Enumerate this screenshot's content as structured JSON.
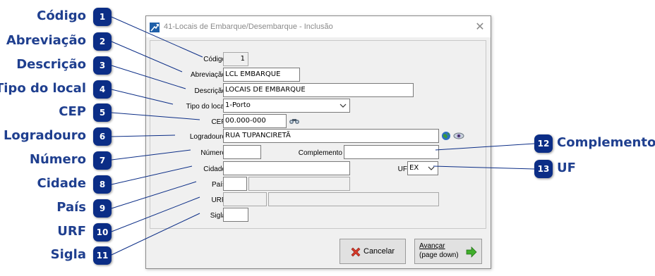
{
  "callouts": [
    {
      "num": "1",
      "label": "Código"
    },
    {
      "num": "2",
      "label": "Abreviação"
    },
    {
      "num": "3",
      "label": "Descrição"
    },
    {
      "num": "4",
      "label": "Tipo do local"
    },
    {
      "num": "5",
      "label": "CEP"
    },
    {
      "num": "6",
      "label": "Logradouro"
    },
    {
      "num": "7",
      "label": "Número"
    },
    {
      "num": "8",
      "label": "Cidade"
    },
    {
      "num": "9",
      "label": "País"
    },
    {
      "num": "10",
      "label": "URF"
    },
    {
      "num": "11",
      "label": "Sigla"
    },
    {
      "num": "12",
      "label": "Complemento"
    },
    {
      "num": "13",
      "label": "UF"
    }
  ],
  "window": {
    "title": "41-Locais de Embarque/Desembarque - Inclusão",
    "close_glyph": "✕"
  },
  "form": {
    "codigo": {
      "label": "Código",
      "value": "1"
    },
    "abreviacao": {
      "label": "Abreviação",
      "value": "LCL EMBARQUE"
    },
    "descricao": {
      "label": "Descrição",
      "value": "LOCAIS DE EMBARQUE"
    },
    "tipo_local": {
      "label": "Tipo do local",
      "value": "1-Porto"
    },
    "cep": {
      "label": "CEP",
      "value": "00.000-000"
    },
    "logradouro": {
      "label": "Logradouro",
      "value": "RUA TUPANCIRETÃ"
    },
    "numero": {
      "label": "Número",
      "value": ""
    },
    "complemento": {
      "label": "Complemento",
      "value": ""
    },
    "cidade": {
      "label": "Cidade",
      "value": ""
    },
    "uf": {
      "label": "UF",
      "value": "EX"
    },
    "pais": {
      "label": "País",
      "code": "",
      "name": ""
    },
    "urf": {
      "label": "URF",
      "code": "",
      "name": ""
    },
    "sigla": {
      "label": "Sigla",
      "value": ""
    }
  },
  "buttons": {
    "cancel": {
      "label": "Cancelar",
      "icon": "red-x-icon"
    },
    "next": {
      "label_line1": "Avançar",
      "label_line2": "(page down)",
      "icon": "green-arrow-icon"
    }
  },
  "icons": {
    "cep_search": "binoculars-icon",
    "globe": "globe-icon",
    "eye": "eye-icon"
  },
  "colors": {
    "badge": "#0b2d86",
    "callout_text": "#1f3f8f"
  }
}
